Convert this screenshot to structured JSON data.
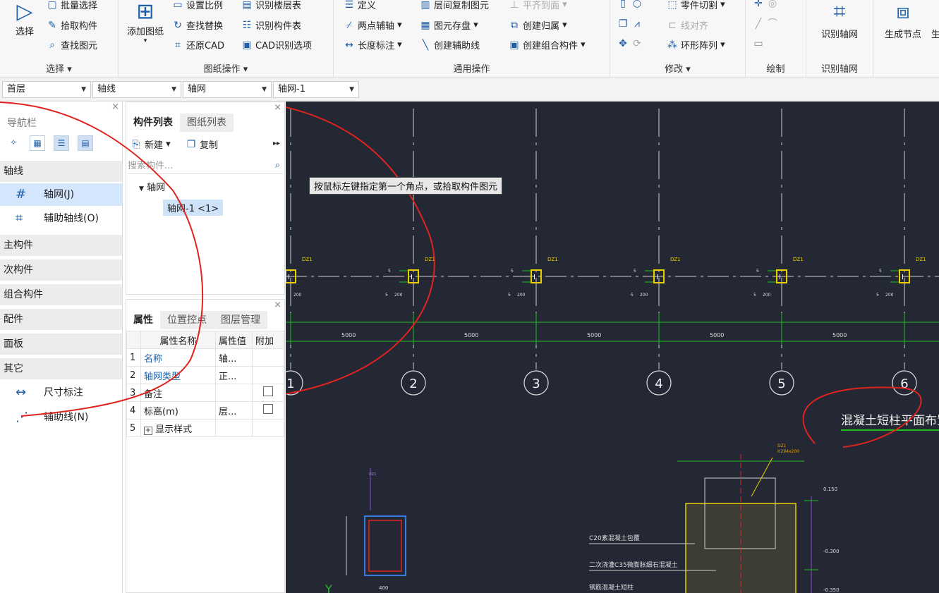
{
  "ribbon": {
    "select_group": {
      "big_button": "选择",
      "items": [
        "批量选择",
        "拾取构件",
        "查找图元"
      ],
      "label": "选择"
    },
    "drawing_group": {
      "big_button": "添加图纸",
      "col1": [
        "设置比例",
        "查找替换",
        "还原CAD"
      ],
      "col2": [
        "识别楼层表",
        "识别构件表",
        "CAD识别选项"
      ],
      "label": "图纸操作"
    },
    "common_group": {
      "col1": [
        "定义",
        "两点辅轴",
        "长度标注"
      ],
      "col2": [
        "层间复制图元",
        "图元存盘",
        "创建辅助线"
      ],
      "col3": [
        "平齐到面",
        "创建归属",
        "创建组合构件"
      ],
      "label": "通用操作"
    },
    "modify_group": {
      "items": [
        "零件切割",
        "线对齐",
        "环形阵列"
      ],
      "label": "修改"
    },
    "draw_group": {
      "label": "绘制"
    },
    "recognize_group": {
      "big_button": "识别轴网",
      "label": "识别轴网"
    },
    "node_group": {
      "big_button": "生成节点",
      "extra": "生"
    }
  },
  "toolbar": {
    "floor": "首层",
    "category": "轴线",
    "type": "轴网",
    "instance": "轴网-1"
  },
  "nav": {
    "title": "导航栏",
    "categories": [
      {
        "label": "轴线"
      },
      {
        "label": "主构件"
      },
      {
        "label": "次构件"
      },
      {
        "label": "组合构件"
      },
      {
        "label": "配件"
      },
      {
        "label": "面板"
      },
      {
        "label": "其它"
      }
    ],
    "axis_items": [
      "轴网(J)",
      "辅助轴线(O)"
    ],
    "other_items": [
      "尺寸标注",
      "辅助线(N)"
    ]
  },
  "complist": {
    "tabs": [
      "构件列表",
      "图纸列表"
    ],
    "new_label": "新建",
    "copy_label": "复制",
    "search_placeholder": "搜索构件...",
    "tree_root": "轴网",
    "tree_child": "轴网-1 <1>"
  },
  "props": {
    "tabs": [
      "属性",
      "位置控点",
      "图层管理"
    ],
    "headers": [
      "属性名称",
      "属性值",
      "附加"
    ],
    "rows": [
      {
        "n": "1",
        "name": "名称",
        "value": "轴..."
      },
      {
        "n": "2",
        "name": "轴网类型",
        "value": "正..."
      },
      {
        "n": "3",
        "name": "备注",
        "value": ""
      },
      {
        "n": "4",
        "name": "标高(m)",
        "value": "层..."
      },
      {
        "n": "5",
        "name": "显示样式",
        "value": ""
      }
    ]
  },
  "canvas": {
    "tooltip": "按鼠标左键指定第一个角点，或拾取构件图元",
    "axis_numbers": [
      "1",
      "2",
      "3",
      "4",
      "5",
      "6"
    ],
    "spacings": [
      "5000",
      "5000",
      "5000",
      "5000",
      "5000"
    ],
    "column_tag": "DZ1",
    "dim_text": "200",
    "side_text": "5",
    "detail_title": "混凝土短柱平面布置图",
    "detail_tag": "DZ1",
    "detail_sub": "H294x200",
    "labels": [
      "C20素混凝土包覆",
      "二次浇灌C35微膨胀细石混凝土",
      "钢筋混凝土短柱"
    ],
    "elev": [
      "0.150",
      "-0.300",
      "-0.350"
    ],
    "section_dim": "400",
    "y_axis": "Y",
    "section_left": "DZ1"
  },
  "colors": {
    "canvas_bg": "#232834",
    "axis_green": "#1fbf1f",
    "annotation_red": "#e0231e",
    "accent": "#1e5fa8"
  }
}
